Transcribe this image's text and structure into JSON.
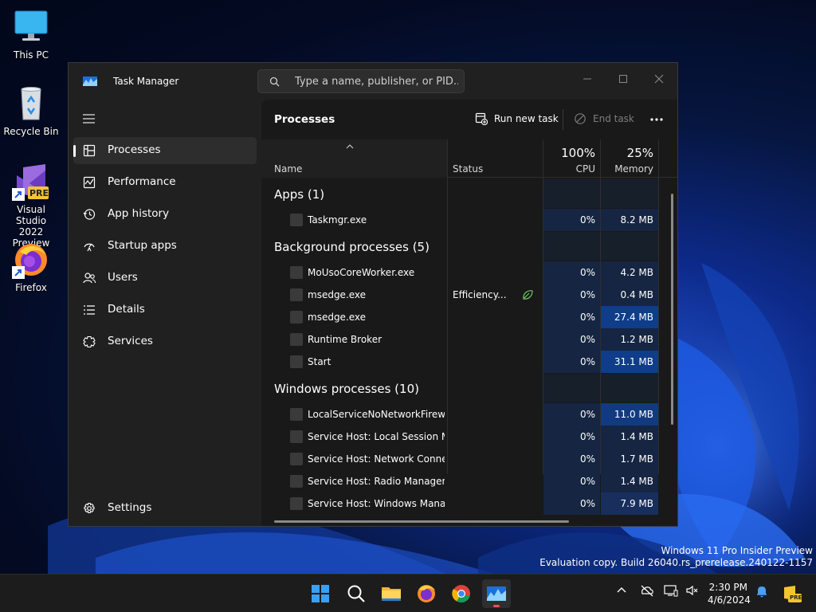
{
  "desktop": {
    "icons": [
      {
        "label": "This PC",
        "icon": "this-pc-icon"
      },
      {
        "label": "Recycle Bin",
        "icon": "recycle-bin-icon"
      },
      {
        "label": "Visual Studio\n2022 Preview",
        "label_line1": "Visual Studio",
        "label_line2": "2022 Preview",
        "badge": "PRE",
        "icon": "visual-studio-icon"
      },
      {
        "label": "Firefox",
        "icon": "firefox-icon"
      }
    ],
    "watermark": {
      "line1": "Windows 11 Pro Insider Preview",
      "line2": "Evaluation copy. Build 26040.rs_prerelease.240122-1157"
    }
  },
  "window": {
    "title": "Task Manager",
    "search_placeholder": "Type a name, publisher, or PID..."
  },
  "sidebar": {
    "items": [
      {
        "label": "Processes",
        "icon": "processes-icon",
        "active": true
      },
      {
        "label": "Performance",
        "icon": "performance-icon"
      },
      {
        "label": "App history",
        "icon": "app-history-icon"
      },
      {
        "label": "Startup apps",
        "icon": "startup-apps-icon"
      },
      {
        "label": "Users",
        "icon": "users-icon"
      },
      {
        "label": "Details",
        "icon": "details-icon"
      },
      {
        "label": "Services",
        "icon": "services-icon"
      }
    ],
    "settings_label": "Settings"
  },
  "toolbar": {
    "page_title": "Processes",
    "run_new_task": "Run new task",
    "end_task": "End task"
  },
  "columns": {
    "name": "Name",
    "status": "Status",
    "cpu_total": "100%",
    "cpu": "CPU",
    "memory_total": "25%",
    "memory": "Memory"
  },
  "groups": [
    {
      "title": "Apps (1)",
      "processes": [
        {
          "name": "Taskmgr.exe",
          "status": "",
          "cpu": "0%",
          "memory": "8.2 MB"
        }
      ]
    },
    {
      "title": "Background processes (5)",
      "processes": [
        {
          "name": "MoUsoCoreWorker.exe",
          "status": "",
          "cpu": "0%",
          "memory": "4.2 MB"
        },
        {
          "name": "msedge.exe",
          "status": "Efficiency...",
          "cpu": "0%",
          "memory": "0.4 MB"
        },
        {
          "name": "msedge.exe",
          "status": "",
          "cpu": "0%",
          "memory": "27.4 MB"
        },
        {
          "name": "Runtime Broker",
          "status": "",
          "cpu": "0%",
          "memory": "1.2 MB"
        },
        {
          "name": "Start",
          "status": "",
          "cpu": "0%",
          "memory": "31.1 MB"
        }
      ]
    },
    {
      "title": "Windows processes (10)",
      "processes": [
        {
          "name": "LocalServiceNoNetworkFirewall",
          "status": "",
          "cpu": "0%",
          "memory": "11.0 MB"
        },
        {
          "name": "Service Host: Local Session M...",
          "status": "",
          "cpu": "0%",
          "memory": "1.4 MB"
        },
        {
          "name": "Service Host: Network Connec...",
          "status": "",
          "cpu": "0%",
          "memory": "1.7 MB"
        },
        {
          "name": "Service Host: Radio Managem...",
          "status": "",
          "cpu": "0%",
          "memory": "1.4 MB"
        },
        {
          "name": "Service Host: Windows Manag...",
          "status": "",
          "cpu": "0%",
          "memory": "7.9 MB"
        }
      ]
    }
  ],
  "taskbar": {
    "apps": [
      "start-icon",
      "search-icon",
      "file-explorer-icon",
      "firefox-icon",
      "chrome-icon",
      "task-manager-icon"
    ],
    "time": "2:30 PM",
    "date": "4/6/2024",
    "tray_badge": "PRE"
  },
  "colors": {
    "window_bg": "#202020",
    "content_bg": "#191919",
    "heat_low": "#152542",
    "heat_high": "#0f3d8a",
    "efficiency_leaf": "#6ccb5f"
  }
}
